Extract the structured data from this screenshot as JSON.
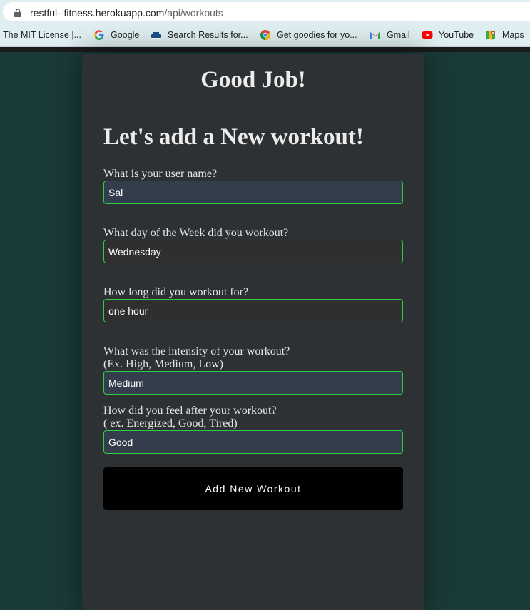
{
  "browser": {
    "url_host": "restful--fitness.herokuapp.com",
    "url_path": "/api/workouts",
    "bookmarks": [
      {
        "label": "The MIT License |...",
        "icon": "none"
      },
      {
        "label": "Google",
        "icon": "google-icon"
      },
      {
        "label": "Search Results for...",
        "icon": "ship-icon"
      },
      {
        "label": "Get goodies for yo...",
        "icon": "chrome-icon"
      },
      {
        "label": "Gmail",
        "icon": "gmail-icon"
      },
      {
        "label": "YouTube",
        "icon": "youtube-icon"
      },
      {
        "label": "Maps",
        "icon": "maps-icon"
      }
    ]
  },
  "page": {
    "title": "Good Job!",
    "subtitle": "Let's add a New workout!",
    "fields": [
      {
        "label": "What is your user name?",
        "value": "Sal"
      },
      {
        "label": "What day of the Week did you workout?",
        "value": "Wednesday"
      },
      {
        "label": "How long did you workout for?",
        "value": "one hour"
      },
      {
        "label": "What was the intensity of your workout?",
        "hint": "(Ex. High, Medium, Low)",
        "value": "Medium"
      },
      {
        "label": "How did you feel after your workout?",
        "hint": "( ex. Energized, Good, Tired)",
        "value": "Good"
      }
    ],
    "submit_label": "Add New Workout"
  },
  "colors": {
    "page_bg": "#1a3a38",
    "card_bg": "#2e3133",
    "input_border": "#2ecc40",
    "button_bg": "#000000"
  }
}
